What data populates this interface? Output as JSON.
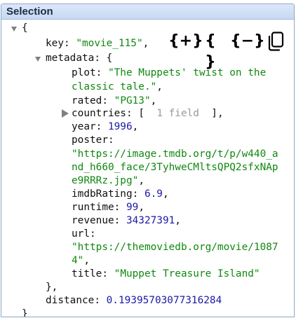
{
  "panel": {
    "title": "Selection"
  },
  "toolbar": {
    "expand_label": "{+}",
    "braces_label": "{ }",
    "collapse_label": "{−}",
    "copy_icon": "copy-icon"
  },
  "json": {
    "open_root": "{",
    "key": {
      "name": "key",
      "value": "\"movie_115\"",
      "comma": ","
    },
    "metadata": {
      "name": "metadata",
      "open": "{",
      "plot": {
        "name": "plot",
        "value_line1": "\"The Muppets' twist on the",
        "value_line2": "classic tale.\"",
        "comma": ","
      },
      "rated": {
        "name": "rated",
        "value": "\"PG13\"",
        "comma": ","
      },
      "countries": {
        "name": "countries",
        "open": "[",
        "summary": "1 field",
        "close": "]",
        "comma": ","
      },
      "year": {
        "name": "year",
        "value": "1996",
        "comma": ","
      },
      "poster": {
        "name": "poster",
        "value_line1": "\"https://image.tmdb.org/t/p/w440_a",
        "value_line2": "nd_h660_face/3TyhweCMltsQPQ2sfxNAp",
        "value_line3": "e9RRRz.jpg\"",
        "comma": ","
      },
      "imdbRating": {
        "name": "imdbRating",
        "value": "6.9",
        "comma": ","
      },
      "runtime": {
        "name": "runtime",
        "value": "99",
        "comma": ","
      },
      "revenue": {
        "name": "revenue",
        "value": "34327391",
        "comma": ","
      },
      "url": {
        "name": "url",
        "value_line1": "\"https://themoviedb.org/movie/1087",
        "value_line2": "4\"",
        "comma": ","
      },
      "title": {
        "name": "title",
        "value": "\"Muppet Treasure Island\""
      },
      "close": "},"
    },
    "distance": {
      "name": "distance",
      "value": "0.19395703077316284"
    },
    "close_root": "}"
  },
  "colors": {
    "string": "#118811",
    "number": "#1a1aa6",
    "placeholder": "#9a9a9a",
    "titlebar": "#c7d9f1",
    "border": "#8fa6c8"
  }
}
